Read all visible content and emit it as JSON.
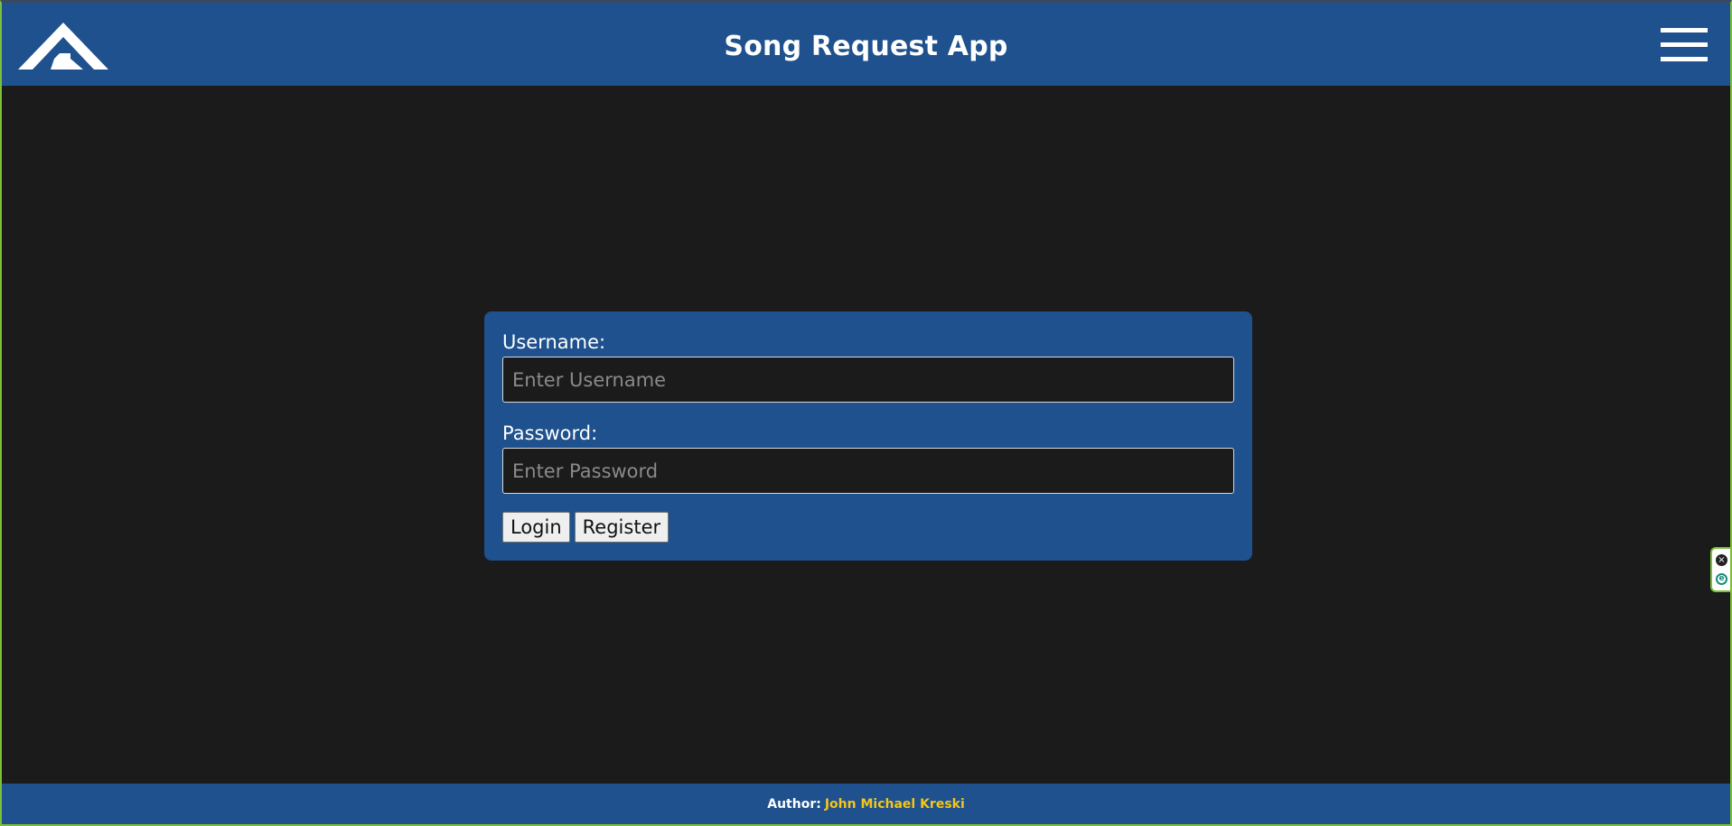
{
  "header": {
    "title": "Song Request App",
    "logo_icon": "app-logo-icon",
    "menu_icon": "hamburger-menu-icon"
  },
  "login_form": {
    "username_label": "Username:",
    "username_placeholder": "Enter Username",
    "username_value": "",
    "password_label": "Password:",
    "password_placeholder": "Enter Password",
    "password_value": "",
    "login_button": "Login",
    "register_button": "Register"
  },
  "footer": {
    "author_label": "Author:",
    "author_name": "John Michael Kreski"
  },
  "side_widget": {
    "close_icon": "close-icon",
    "extension_icon": "extension-e-icon"
  },
  "colors": {
    "primary": "#1e518d",
    "background": "#1b1b1b",
    "accent": "#f5c518",
    "frame_border": "#7bbf3a"
  }
}
